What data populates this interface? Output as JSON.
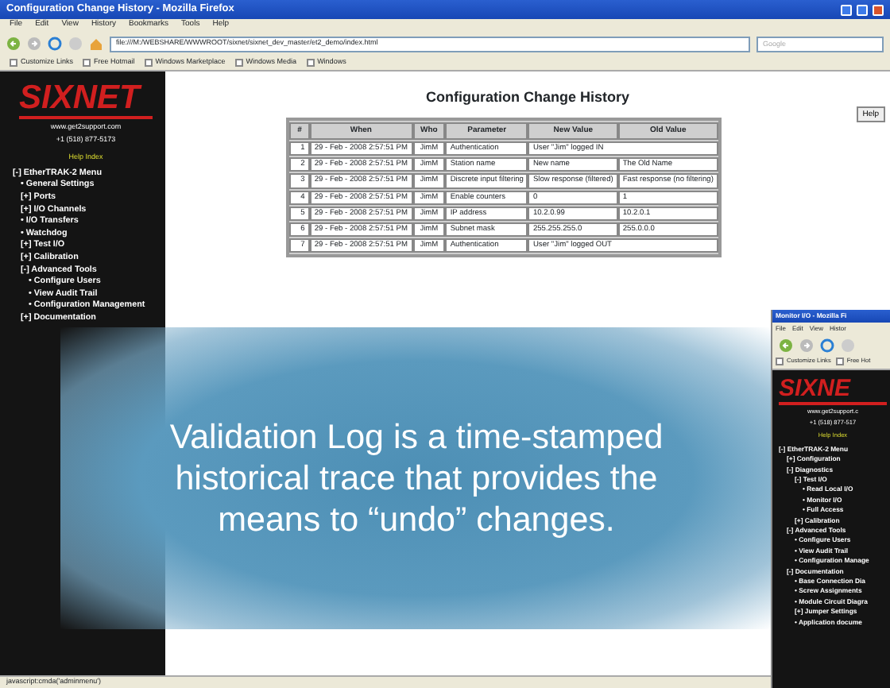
{
  "main_window": {
    "title": "Configuration Change History - Mozilla Firefox",
    "menu": [
      "File",
      "Edit",
      "View",
      "History",
      "Bookmarks",
      "Tools",
      "Help"
    ],
    "address": "file:///M:/WEBSHARE/WWWROOT/sixnet/sixnet_dev_master/et2_demo/index.html",
    "search_placeholder": "Google",
    "bookmarks": [
      "Customize Links",
      "Free Hotmail",
      "Windows Marketplace",
      "Windows Media",
      "Windows"
    ],
    "sidebar": {
      "logo": "SIXNET",
      "website": "www.get2support.com",
      "phone": "+1 (518) 877-5173",
      "help_link": "Help Index",
      "menu": [
        {
          "label": "[-] EtherTRAK-2 Menu",
          "children": [
            {
              "label": "• General Settings"
            },
            {
              "label": "[+] Ports"
            },
            {
              "label": "[+] I/O Channels"
            },
            {
              "label": "• I/O Transfers"
            },
            {
              "label": "• Watchdog"
            },
            {
              "label": "[+] Test I/O"
            },
            {
              "label": "[+] Calibration"
            },
            {
              "label": "[-] Advanced Tools",
              "children": [
                {
                  "label": "• Configure Users"
                },
                {
                  "label": "• View Audit Trail"
                },
                {
                  "label": "• Configuration Management"
                }
              ]
            },
            {
              "label": "[+] Documentation"
            }
          ]
        }
      ]
    },
    "page": {
      "heading": "Configuration Change History",
      "help_button": "Help",
      "table": {
        "columns": [
          "#",
          "When",
          "Who",
          "Parameter",
          "New Value",
          "Old Value"
        ],
        "rows": [
          {
            "cells": [
              "1",
              "29 - Feb - 2008 2:57:51 PM",
              "JimM",
              "Authentication",
              "User \"Jim\" logged IN"
            ]
          },
          {
            "cells": [
              "2",
              "29 - Feb - 2008 2:57:51 PM",
              "JimM",
              "Station name",
              "New name",
              "The Old Name"
            ]
          },
          {
            "cells": [
              "3",
              "29 - Feb - 2008 2:57:51 PM",
              "JimM",
              "Discrete input filtering",
              "Slow response (filtered)",
              "Fast response (no filtering)"
            ]
          },
          {
            "cells": [
              "4",
              "29 - Feb - 2008 2:57:51 PM",
              "JimM",
              "Enable counters",
              "0",
              "1"
            ]
          },
          {
            "cells": [
              "5",
              "29 - Feb - 2008 2:57:51 PM",
              "JimM",
              "IP address",
              "10.2.0.99",
              "10.2.0.1"
            ]
          },
          {
            "cells": [
              "6",
              "29 - Feb - 2008 2:57:51 PM",
              "JimM",
              "Subnet mask",
              "255.255.255.0",
              "255.0.0.0"
            ]
          },
          {
            "cells": [
              "7",
              "29 - Feb - 2008 2:57:51 PM",
              "JimM",
              "Authentication",
              "User \"Jim\" logged OUT"
            ]
          }
        ]
      }
    },
    "status_bar": "javascript:cmda('adminmenu')"
  },
  "second_window": {
    "title": "Monitor I/O - Mozilla Fi",
    "menu": [
      "File",
      "Edit",
      "View",
      "Histor"
    ],
    "bookmarks": [
      "Customize Links",
      "Free Hot"
    ],
    "sidebar": {
      "logo": "SIXNE",
      "website": "www.get2support.c",
      "phone": "+1 (518) 877-517",
      "help_link": "Help Index",
      "menu": [
        {
          "label": "[-] EtherTRAK-2 Menu",
          "children": [
            {
              "label": "[+] Configuration"
            },
            {
              "label": "[-] Diagnostics",
              "children": [
                {
                  "label": "[-] Test I/O",
                  "children": [
                    {
                      "label": "• Read Local I/O"
                    },
                    {
                      "label": "• Monitor I/O"
                    },
                    {
                      "label": "• Full Access"
                    }
                  ]
                },
                {
                  "label": "[+] Calibration"
                }
              ]
            },
            {
              "label": "[-] Advanced Tools",
              "children": [
                {
                  "label": "• Configure Users"
                },
                {
                  "label": "• View Audit Trail"
                },
                {
                  "label": "• Configuration Manage"
                }
              ]
            },
            {
              "label": "[-] Documentation",
              "children": [
                {
                  "label": "• Base Connection Dia"
                },
                {
                  "label": "• Screw Assignments"
                },
                {
                  "label": "• Module Circuit Diagra"
                },
                {
                  "label": "[+] Jumper Settings"
                },
                {
                  "label": "• Application docume"
                }
              ]
            }
          ]
        }
      ]
    }
  },
  "callout": {
    "text": "Validation Log is a time-stamped historical trace that provides the means to “undo” changes."
  }
}
